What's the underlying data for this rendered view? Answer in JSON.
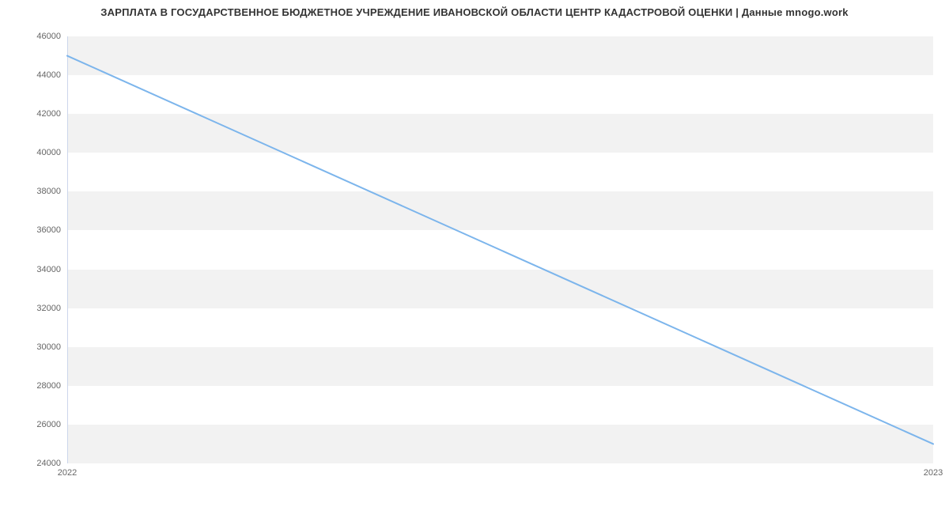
{
  "chart_data": {
    "type": "line",
    "title": "ЗАРПЛАТА В ГОСУДАРСТВЕННОЕ БЮДЖЕТНОЕ УЧРЕЖДЕНИЕ ИВАНОВСКОЙ ОБЛАСТИ ЦЕНТР КАДАСТРОВОЙ ОЦЕНКИ | Данные mnogo.work",
    "x": [
      2022,
      2023
    ],
    "values": [
      45000,
      25000
    ],
    "xlabel": "",
    "ylabel": "",
    "xlim": [
      2022,
      2023
    ],
    "ylim": [
      24000,
      46000
    ],
    "yticks": [
      24000,
      26000,
      28000,
      30000,
      32000,
      34000,
      36000,
      38000,
      40000,
      42000,
      44000,
      46000
    ],
    "xticks": [
      2022,
      2023
    ],
    "series_color": "#7cb5ec"
  }
}
